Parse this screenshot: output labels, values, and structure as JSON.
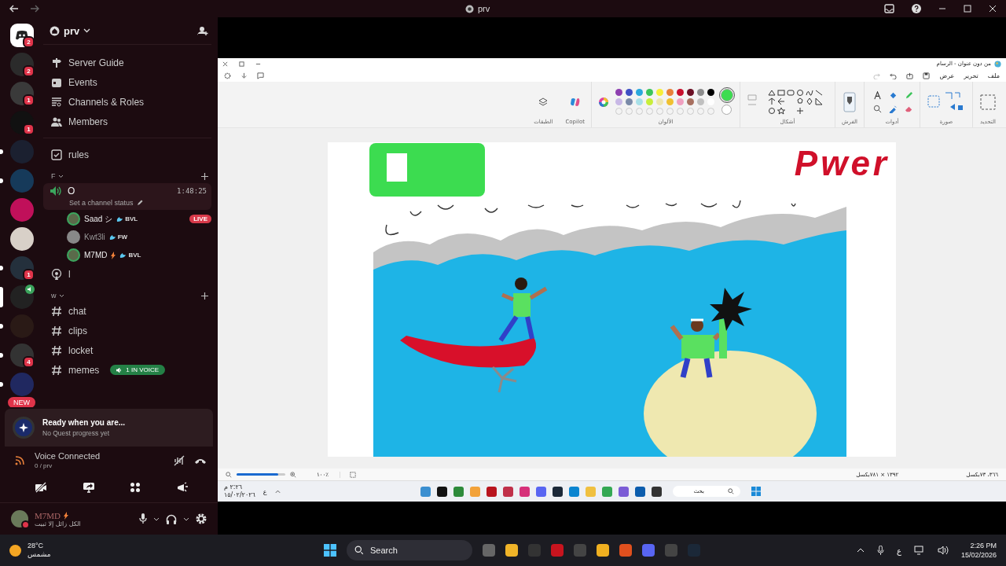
{
  "titlebar": {
    "title": "prv"
  },
  "servers": [
    {
      "badge": "2",
      "unread": false,
      "selected": false
    },
    {
      "badge": "2",
      "unread": false,
      "selected": false
    },
    {
      "badge": "1",
      "unread": false,
      "selected": false
    },
    {
      "badge": "1",
      "unread": false,
      "selected": false
    },
    {
      "unread": true,
      "selected": false
    },
    {
      "unread": true,
      "selected": false
    },
    {
      "unread": false,
      "selected": false
    },
    {
      "unread": false,
      "selected": false
    },
    {
      "badge": "1",
      "unread": true,
      "selected": false
    },
    {
      "unread": false,
      "selected": true,
      "in_voice": true
    },
    {
      "unread": true,
      "selected": false
    },
    {
      "badge": "4",
      "unread": true,
      "selected": false
    },
    {
      "unread": true,
      "selected": false
    }
  ],
  "new_badge": "NEW",
  "server": {
    "name": "prv"
  },
  "guide_items": [
    {
      "kind": "guide",
      "label": "Server Guide"
    },
    {
      "kind": "events",
      "label": "Events"
    },
    {
      "kind": "roles",
      "label": "Channels & Roles"
    },
    {
      "kind": "members",
      "label": "Members"
    }
  ],
  "top_channels": [
    {
      "name": "rules"
    }
  ],
  "categories": [
    {
      "name": "F",
      "channels": [
        {
          "kind": "voice",
          "name": "O",
          "timer": "1:48:25",
          "status": "Set a channel status",
          "selected": true,
          "members": [
            {
              "name": "Saad シ",
              "tag": "BVL",
              "live": "LIVE",
              "idle": false
            },
            {
              "name": "Kwt3li",
              "tag": "FW",
              "idle": true
            },
            {
              "name": "M7MD",
              "tag": "BVL",
              "idle": false
            }
          ]
        },
        {
          "kind": "stage",
          "name": "l",
          "selected": false
        }
      ]
    },
    {
      "name": "w",
      "channels": [
        {
          "kind": "text",
          "name": "chat",
          "selected": false
        },
        {
          "kind": "text",
          "name": "clips",
          "selected": false
        },
        {
          "kind": "text",
          "name": "locket",
          "selected": false
        },
        {
          "kind": "text",
          "name": "memes",
          "selected": false,
          "voice_pill": "1 IN VOICE"
        }
      ]
    }
  ],
  "quest": {
    "title": "Ready when you are...",
    "subtitle": "No Quest progress yet"
  },
  "voice": {
    "status": "Voice Connected",
    "location": "0 / prv"
  },
  "user": {
    "name": "M7MD",
    "status": "الكل زائل إلا ثبيت"
  },
  "paint": {
    "title": "من دون عنوان - الرسام",
    "menu": [
      "ملف",
      "تحرير",
      "عرض"
    ],
    "groups": [
      {
        "kind": "selection",
        "label": "التحديد"
      },
      {
        "kind": "image",
        "label": "صورة"
      },
      {
        "kind": "tools",
        "label": "أدوات"
      },
      {
        "kind": "brushes",
        "label": "الفرش"
      },
      {
        "kind": "shapes",
        "label": "أشكال"
      },
      {
        "kind": "colors",
        "label": "الألوان"
      },
      {
        "kind": "copilot",
        "label": "Copilot"
      },
      {
        "kind": "layers",
        "label": "الطبقات"
      }
    ],
    "palette": [
      {
        "color": "#8e3fb0"
      },
      {
        "color": "#3d4fc4"
      },
      {
        "color": "#2aa8dc"
      },
      {
        "color": "#3cc45a"
      },
      {
        "color": "#f6ee3a"
      },
      {
        "color": "#e8803a"
      },
      {
        "color": "#c8102e"
      },
      {
        "color": "#6b0f24"
      },
      {
        "color": "#8c8c8c"
      },
      {
        "color": "#000000"
      },
      {
        "color": "#c8b8e6"
      },
      {
        "color": "#7a8aa8"
      },
      {
        "color": "#a8e0e8"
      },
      {
        "color": "#c8ee3a"
      },
      {
        "color": "#eee6b0"
      },
      {
        "color": "#f0c030"
      },
      {
        "color": "#f0a0c0"
      },
      {
        "color": "#a87060"
      },
      {
        "color": "#c0c0c0"
      },
      {
        "color": "#ffffff"
      }
    ],
    "current_colors": [
      {
        "color": "#3cdc50",
        "selected": true
      },
      {
        "color": "#ffffff",
        "selected": false
      }
    ],
    "scribble": "Pwer",
    "zoom_slider": {
      "level": 0.85
    },
    "zoom": "١٠٠٪",
    "cursor_pos": "٣٦٦، ٧٣بكسل",
    "canvas_size": "١٣٩٢ × ٧٨١بكسل",
    "taskbar": {
      "search": "بحث",
      "lang": "ع",
      "time": "٢:٢٦ م",
      "date": "١٥/٠٢/٢٠٢٦"
    }
  },
  "taskbar": {
    "temp": "28°C",
    "condition": "مشمس",
    "search": "Search",
    "lang": "ع",
    "time": "2:26 PM",
    "date": "15/02/2026"
  }
}
